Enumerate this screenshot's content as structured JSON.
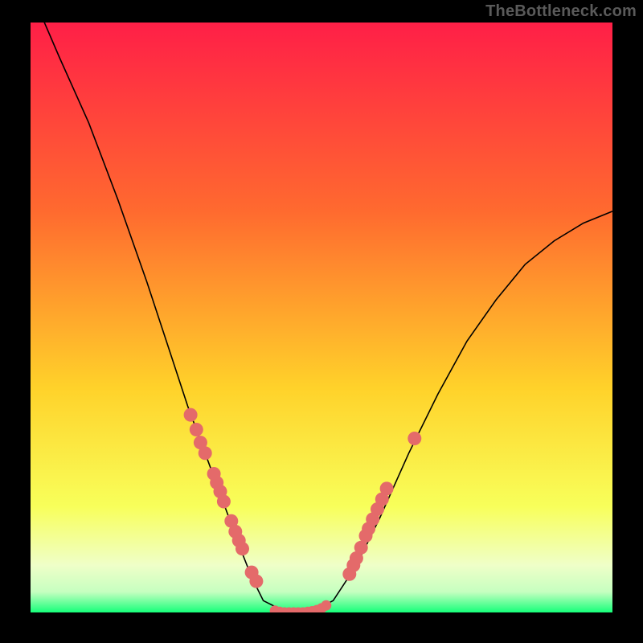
{
  "attribution": "TheBottleneck.com",
  "colors": {
    "gradient_top": "#ff1f47",
    "gradient_upper_mid": "#ff6a2f",
    "gradient_mid": "#ffd22a",
    "gradient_lower_mid": "#f8ff5a",
    "gradient_pale": "#efffc8",
    "gradient_bottom": "#16ff7a",
    "curve": "#000000",
    "dots": "#e46a6a",
    "frame": "#000000"
  },
  "chart_data": {
    "type": "line",
    "title": "",
    "xlabel": "",
    "ylabel": "",
    "xlim": [
      0,
      1
    ],
    "ylim": [
      0,
      1
    ],
    "series": [
      {
        "name": "bottleneck-curve",
        "x": [
          0.0,
          0.05,
          0.1,
          0.15,
          0.2,
          0.24,
          0.27,
          0.3,
          0.33,
          0.36,
          0.38,
          0.4,
          0.44,
          0.48,
          0.52,
          0.56,
          0.6,
          0.65,
          0.7,
          0.75,
          0.8,
          0.85,
          0.9,
          0.95,
          1.0
        ],
        "y": [
          1.02,
          0.94,
          0.83,
          0.7,
          0.56,
          0.44,
          0.35,
          0.27,
          0.19,
          0.11,
          0.06,
          0.02,
          0.0,
          0.0,
          0.02,
          0.08,
          0.16,
          0.27,
          0.37,
          0.46,
          0.53,
          0.59,
          0.63,
          0.66,
          0.68
        ]
      }
    ],
    "scatter_points": {
      "left_branch": [
        {
          "x": 0.275,
          "y": 0.335
        },
        {
          "x": 0.285,
          "y": 0.31
        },
        {
          "x": 0.292,
          "y": 0.288
        },
        {
          "x": 0.3,
          "y": 0.27
        },
        {
          "x": 0.315,
          "y": 0.235
        },
        {
          "x": 0.32,
          "y": 0.22
        },
        {
          "x": 0.326,
          "y": 0.205
        },
        {
          "x": 0.332,
          "y": 0.188
        },
        {
          "x": 0.345,
          "y": 0.155
        },
        {
          "x": 0.352,
          "y": 0.137
        },
        {
          "x": 0.358,
          "y": 0.122
        },
        {
          "x": 0.364,
          "y": 0.108
        },
        {
          "x": 0.38,
          "y": 0.068
        },
        {
          "x": 0.388,
          "y": 0.053
        }
      ],
      "valley": [
        {
          "x": 0.42,
          "y": 0.003
        },
        {
          "x": 0.428,
          "y": 0.001
        },
        {
          "x": 0.436,
          "y": 0.0
        },
        {
          "x": 0.444,
          "y": 0.0
        },
        {
          "x": 0.452,
          "y": 0.0
        },
        {
          "x": 0.46,
          "y": 0.0
        },
        {
          "x": 0.468,
          "y": 0.0
        },
        {
          "x": 0.476,
          "y": 0.001
        },
        {
          "x": 0.484,
          "y": 0.002
        },
        {
          "x": 0.492,
          "y": 0.004
        },
        {
          "x": 0.5,
          "y": 0.007
        },
        {
          "x": 0.508,
          "y": 0.012
        }
      ],
      "right_branch": [
        {
          "x": 0.548,
          "y": 0.065
        },
        {
          "x": 0.555,
          "y": 0.08
        },
        {
          "x": 0.56,
          "y": 0.092
        },
        {
          "x": 0.568,
          "y": 0.11
        },
        {
          "x": 0.576,
          "y": 0.13
        },
        {
          "x": 0.581,
          "y": 0.142
        },
        {
          "x": 0.588,
          "y": 0.158
        },
        {
          "x": 0.596,
          "y": 0.175
        },
        {
          "x": 0.604,
          "y": 0.192
        },
        {
          "x": 0.612,
          "y": 0.21
        },
        {
          "x": 0.66,
          "y": 0.295
        }
      ]
    }
  }
}
